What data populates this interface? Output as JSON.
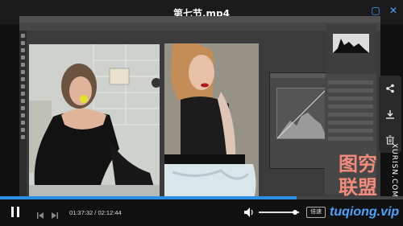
{
  "window": {
    "title": "第七节.mp4",
    "restore_icon": "restore-icon",
    "close_icon": "close-icon"
  },
  "player": {
    "current_time": "01:37:32",
    "duration": "02:12:44",
    "time_separator": " / ",
    "progress": 0.735,
    "volume": 0.9,
    "speed_label": "倍速",
    "accent_color": "#2b8fe8"
  },
  "side_actions": [
    {
      "name": "share-icon"
    },
    {
      "name": "download-icon"
    },
    {
      "name": "delete-icon"
    }
  ],
  "watermark": {
    "vertical_text": "XURISN.COM",
    "chinese_line1": "图穷",
    "chinese_line2": "联盟",
    "url": "tuqiong.vip"
  }
}
